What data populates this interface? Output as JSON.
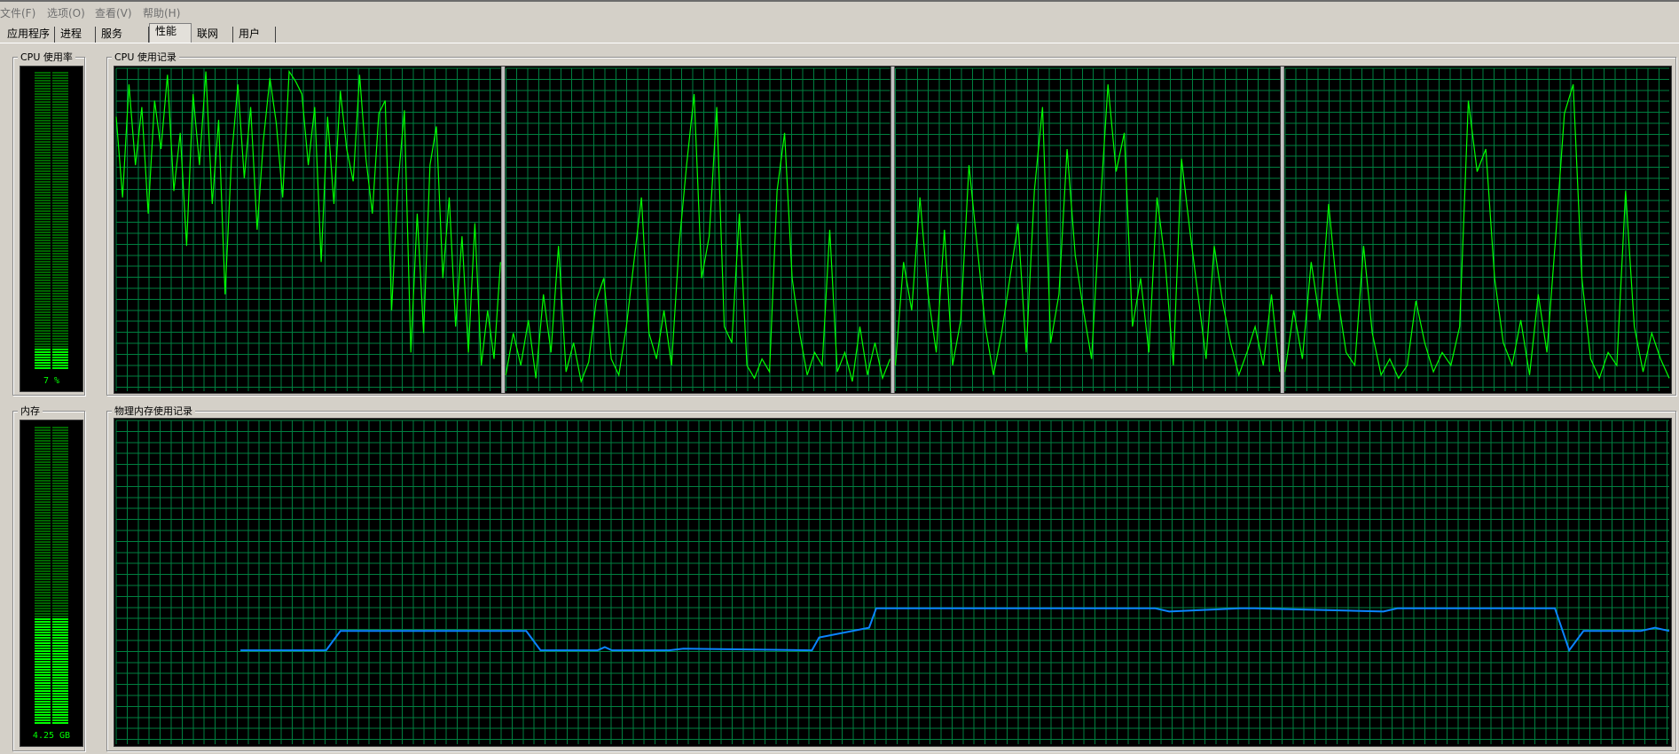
{
  "menu": [
    {
      "label": "文件(F)"
    },
    {
      "label": "选项(O)"
    },
    {
      "label": "查看(V)"
    },
    {
      "label": "帮助(H)"
    }
  ],
  "tabs": [
    {
      "label": "应用程序"
    },
    {
      "label": "进程"
    },
    {
      "label": "服务"
    },
    {
      "label": "性能",
      "active": true
    },
    {
      "label": "联网"
    },
    {
      "label": "用户"
    }
  ],
  "cpu_usage": {
    "label": "CPU 使用率",
    "value_text": "7 %",
    "level": 0.07
  },
  "cpu_history": {
    "label": "CPU 使用记录"
  },
  "memory": {
    "label": "内存",
    "value_text": "4.25 GB",
    "level": 0.36
  },
  "memory_history": {
    "label": "物理内存使用记录"
  },
  "colors": {
    "grid": "#008040",
    "cpu_line": "#00ff00",
    "mem_line": "#0a84ff",
    "meter_off": "#006400",
    "meter_on": "#00ff00"
  },
  "chart_data": [
    {
      "type": "line",
      "ylim": [
        0,
        100
      ],
      "series": [
        {
          "values": [
            85,
            60,
            95,
            70,
            88,
            55,
            90,
            75,
            98,
            62,
            80,
            45,
            92,
            70,
            99,
            58,
            84,
            30,
            72,
            95,
            66,
            88,
            50,
            78,
            97,
            83,
            60,
            99,
            96,
            92,
            70,
            88,
            40,
            85,
            58,
            93,
            75,
            65,
            98,
            72,
            55,
            86,
            90,
            25,
            64,
            87,
            12,
            55,
            18,
            70,
            82,
            35,
            60,
            20,
            48,
            12,
            52,
            8,
            25,
            10,
            40
          ]
        },
        {
          "values": [
            5,
            18,
            8,
            22,
            4,
            30,
            12,
            45,
            6,
            15,
            3,
            9,
            28,
            35,
            10,
            5,
            20,
            40,
            60,
            18,
            10,
            25,
            8,
            45,
            70,
            92,
            35,
            48,
            88,
            20,
            15,
            55,
            8,
            4,
            10,
            6,
            62,
            80,
            35,
            18,
            5,
            12,
            8,
            50,
            6,
            12,
            3,
            20,
            5,
            15,
            4,
            10
          ]
        },
        {
          "values": [
            8,
            40,
            25,
            60,
            30,
            12,
            50,
            8,
            22,
            70,
            45,
            20,
            5,
            18,
            35,
            52,
            12,
            62,
            88,
            15,
            30,
            75,
            42,
            25,
            10,
            55,
            95,
            68,
            80,
            20,
            35,
            12,
            60,
            40,
            8,
            72,
            50,
            30,
            10,
            45,
            28,
            15,
            5,
            12,
            20,
            8,
            30,
            6
          ]
        },
        {
          "values": [
            6,
            25,
            10,
            40,
            22,
            58,
            30,
            12,
            8,
            45,
            18,
            5,
            10,
            4,
            8,
            28,
            15,
            6,
            12,
            8,
            20,
            90,
            68,
            75,
            35,
            15,
            8,
            22,
            5,
            30,
            12,
            48,
            86,
            95,
            35,
            10,
            4,
            12,
            8,
            62,
            20,
            6,
            18,
            10,
            4
          ]
        }
      ]
    },
    {
      "type": "line",
      "ylim": [
        0,
        100
      ],
      "series": [
        {
          "x": [
            0,
            6,
            7,
            20,
            21,
            25,
            25.5,
            26,
            30,
            31,
            40,
            40.5,
            44,
            44.5,
            64,
            65,
            70,
            71,
            80,
            81,
            92,
            93,
            94,
            95,
            96,
            98,
            99,
            100
          ],
          "values": [
            29,
            29,
            35,
            35,
            29,
            29,
            30,
            29,
            29,
            29.5,
            29,
            33,
            36,
            42,
            42,
            41,
            42,
            42,
            41,
            42,
            42,
            29,
            35,
            35,
            35,
            35,
            36,
            35
          ]
        }
      ]
    }
  ]
}
